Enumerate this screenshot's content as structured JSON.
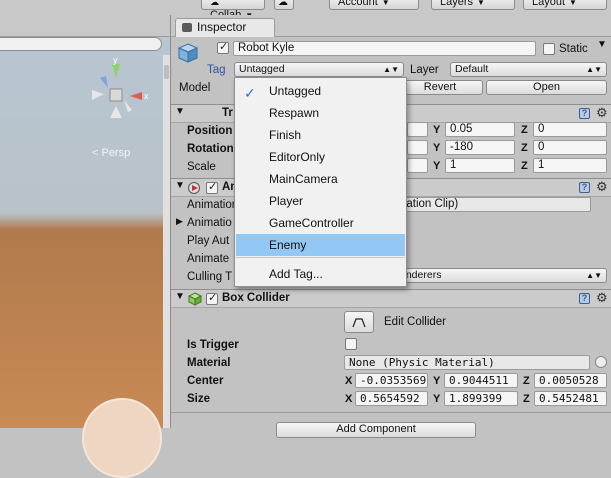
{
  "toolbar": {
    "collab_label": "Collab",
    "account_label": "Account",
    "layers_label": "Layers",
    "layout_label": "Layout"
  },
  "scene": {
    "persp_label": "< Persp",
    "gizmo_axes": {
      "y": "y",
      "x": "x"
    }
  },
  "inspector": {
    "tab_label": "Inspector",
    "object_name": "Robot Kyle",
    "static_label": "Static",
    "tag_label": "Tag",
    "tag_value": "Untagged",
    "layer_label": "Layer",
    "layer_value": "Default",
    "model_label": "Model",
    "revert_label": "Revert",
    "open_label": "Open",
    "transform": {
      "header_fragment": "Tr",
      "position_label": "Position",
      "rotation_label": "Rotation",
      "scale_label": "Scale",
      "position": {
        "y": "0.05",
        "z": "0"
      },
      "rotation": {
        "y": "-180",
        "z": "0"
      },
      "scale": {
        "y": "1",
        "z": "1"
      }
    },
    "animator": {
      "header_fragment": "An",
      "controller_label": "Animation",
      "controller_value": "nation Clip)",
      "avatar_label": "Animatio",
      "apply_root_label": "Play Aut",
      "update_mode_label": "Animate",
      "culling_label": "Culling T",
      "culling_value": "enderers"
    },
    "box_collider": {
      "header": "Box Collider",
      "edit_label": "Edit Collider",
      "is_trigger_label": "Is Trigger",
      "material_label": "Material",
      "material_value": "None (Physic Material)",
      "center_label": "Center",
      "size_label": "Size",
      "center": {
        "x": "-0.0353569",
        "y": "0.9044511",
        "z": "0.0050528"
      },
      "size": {
        "x": "0.5654592",
        "y": "1.899399",
        "z": "0.5452481"
      }
    },
    "add_component_label": "Add Component"
  },
  "axis": {
    "x": "X",
    "y": "Y",
    "z": "Z"
  },
  "tag_menu": {
    "items": [
      "Untagged",
      "Respawn",
      "Finish",
      "EditorOnly",
      "MainCamera",
      "Player",
      "GameController",
      "Enemy"
    ],
    "add_tag": "Add Tag...",
    "checked": "Untagged",
    "highlighted": "Enemy"
  },
  "colors": {
    "highlight": "#92c8f3",
    "panel": "#c2c2c2",
    "check": "#2c6fd4"
  }
}
